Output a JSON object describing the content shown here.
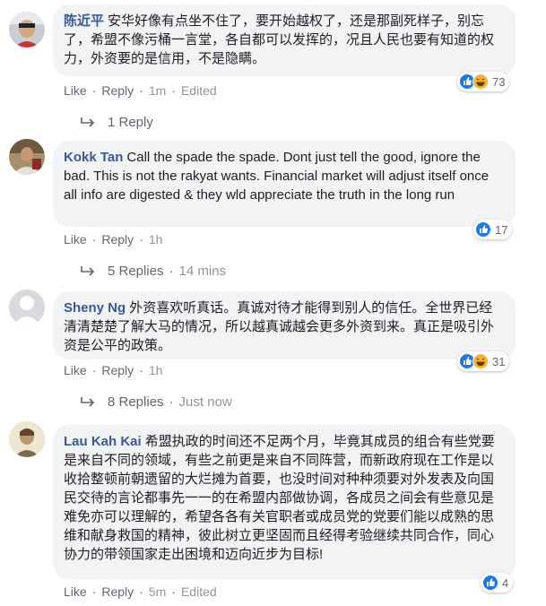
{
  "comments": [
    {
      "author": "陈近平",
      "text": "安华好像有点坐不住了，要开始越权了，还是那副死样子，别忘了，希盟不像污桶一言堂，各自都可以发挥的，况且人民也要有知道的权力，外资要的是信用，不是隐瞒。",
      "like": "Like",
      "reply": "Reply",
      "time": "1m",
      "edited": "Edited",
      "reaction_count": "73",
      "reactions": [
        "like-icon",
        "haha-icon"
      ],
      "replies_text": "1 Reply",
      "replies_time": ""
    },
    {
      "author": "Kokk Tan",
      "text": "Call the spade the spade. Dont just tell the good, ignore the bad. This is not the rakyat wants. Financial market will adjust itself once all info are digested & they wld appreciate the truth in the long run",
      "like": "Like",
      "reply": "Reply",
      "time": "1h",
      "edited": "",
      "reaction_count": "17",
      "reactions": [
        "like-icon"
      ],
      "replies_text": "5 Replies",
      "replies_time": "14 mins"
    },
    {
      "author": "Sheny Ng",
      "text": "外资喜欢听真话。真诚对待才能得到别人的信任。全世界已经清清楚楚了解大马的情况，所以越真诚越会更多外资到来。真正是吸引外资是公平的政策。",
      "like": "Like",
      "reply": "Reply",
      "time": "1h",
      "edited": "",
      "reaction_count": "31",
      "reactions": [
        "like-icon",
        "haha-icon"
      ],
      "replies_text": "8 Replies",
      "replies_time": "Just now"
    },
    {
      "author": "Lau Kah Kai",
      "text": "希盟执政的时间还不足两个月，毕竟其成员的组合有些党要是来自不同的领域，有些之前更是来自不同阵营，而新政府现在工作是以收拾整顿前朝遗留的大烂摊为首要，也没时间对种种须要对外发表及向国民交待的言论都事先一一的在希盟内部做协调，各成员之间会有些意见是难免亦可以理解的，希望各各有关官职者或成员党的党要们能以成熟的思维和献身救国的精神，彼此树立更坚固而且经得考验继续共同合作，同心协力的带领国家走出困境和迈向近步为目标!",
      "like": "Like",
      "reply": "Reply",
      "time": "5m",
      "edited": "Edited",
      "reaction_count": "4",
      "reactions": [
        "like-icon"
      ],
      "replies_text": "",
      "replies_time": ""
    }
  ],
  "colors": {
    "author": "#385898",
    "bubble": "#f2f3f5",
    "meta": "#606770",
    "like_blue": "#1877f2",
    "haha_yellow": "#f7b125"
  }
}
